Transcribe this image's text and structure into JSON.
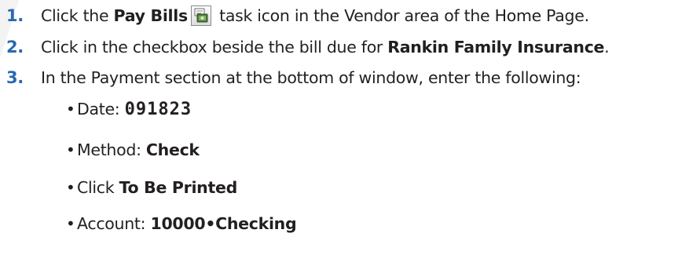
{
  "steps": [
    {
      "number": "1.",
      "text_before": "Click the ",
      "bold": "Pay Bills",
      "icon": "pay-bills-task-icon",
      "text_after": " task icon in the Vendor area of the Home Page."
    },
    {
      "number": "2.",
      "text_before": "Click in the checkbox beside the bill due for ",
      "bold": "Rankin Family Insurance",
      "text_after": "."
    },
    {
      "number": "3.",
      "text": "In the Payment section at the bottom of window, enter the following:"
    }
  ],
  "sub_items": [
    {
      "bullet": "•",
      "label": "Date: ",
      "value": "091823"
    },
    {
      "bullet": "•",
      "label": "Method: ",
      "value": "Check"
    },
    {
      "bullet": "•",
      "label": "Click ",
      "value": "To Be Printed"
    },
    {
      "bullet": "•",
      "label": "Account: ",
      "value": "10000•Checking"
    }
  ],
  "colors": {
    "step_number": "#2a68b1",
    "text": "#231f20"
  }
}
